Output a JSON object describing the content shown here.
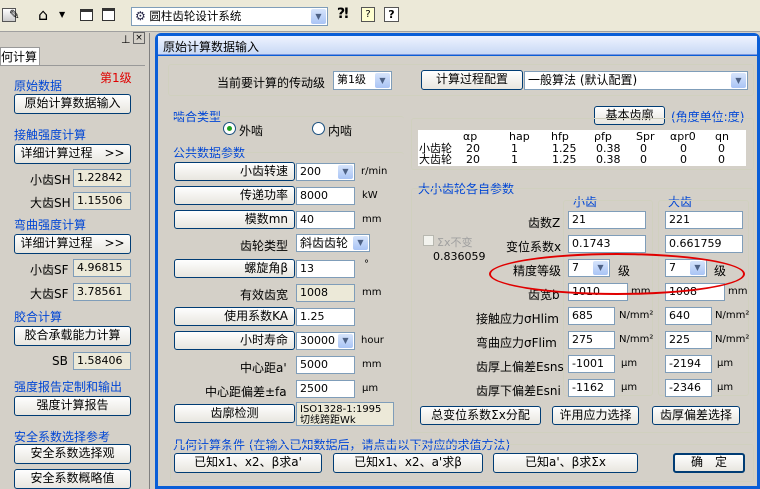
{
  "toolbar": {
    "system_select": "圆柱齿轮设计系统"
  },
  "left": {
    "tab": "何计算",
    "stage": "第1级",
    "sections": {
      "raw": "原始数据",
      "raw_btn": "原始计算数据输入",
      "contact": "接触强度计算",
      "contact_btn": "详细计算过程　>>",
      "sh_small_label": "小齿SH",
      "sh_small": "1.22842",
      "sh_big_label": "大齿SH",
      "sh_big": "1.15506",
      "bend": "弯曲强度计算",
      "bend_btn": "详细计算过程　>>",
      "sf_small_label": "小齿SF",
      "sf_small": "4.96815",
      "sf_big_label": "大齿SF",
      "sf_big": "3.78561",
      "glue": "胶合计算",
      "glue_btn": "胶合承载能力计算",
      "sb_label": "SB",
      "sb": "1.58406",
      "report": "强度报告定制和输出",
      "report_btn": "强度计算报告",
      "safety": "安全系数选择参考",
      "safety_btn1": "安全系数选择观",
      "safety_btn2": "安全系数概略值"
    }
  },
  "dialog": {
    "title": "原始计算数据输入",
    "stage_label": "当前要计算的传动级",
    "stage_value": "第1级",
    "config_btn": "计算过程配置",
    "algo_value": "一般算法 (默认配置)",
    "basic_rack_btn": "基本齿廓",
    "angle_unit": "(角度单位:度)",
    "mesh_type": {
      "title": "啮合类型",
      "outer": "外啮",
      "inner": "内啮"
    },
    "rack_table": {
      "headers": [
        "αp",
        "hap",
        "hfp",
        "ρfp",
        "Spr",
        "αpr0",
        "qn"
      ],
      "rows": [
        {
          "name": "小齿轮",
          "vals": [
            "20",
            "1",
            "1.25",
            "0.38",
            "0",
            "0",
            "0"
          ]
        },
        {
          "name": "大齿轮",
          "vals": [
            "20",
            "1",
            "1.25",
            "0.38",
            "0",
            "0",
            "0"
          ]
        }
      ]
    },
    "common": {
      "title": "公共数据参数",
      "speed_btn": "小齿转速",
      "speed": "200",
      "speed_unit": "r/min",
      "power_btn": "传递功率",
      "power": "8000",
      "power_unit": "kW",
      "module_btn": "模数mn",
      "module": "40",
      "module_unit": "mm",
      "geartype_label": "齿轮类型",
      "geartype": "斜齿齿轮",
      "helix_btn": "螺旋角β",
      "helix": "13",
      "helix_unit": "°",
      "width_label": "有效齿宽",
      "width": "1008",
      "width_unit": "mm",
      "ka_btn": "使用系数KA",
      "ka": "1.25",
      "life_btn": "小时寿命",
      "life": "30000",
      "life_unit": "hour",
      "center_label": "中心距a'",
      "center": "5000",
      "center_unit": "mm",
      "fa_label": "中心距偏差±fa",
      "fa": "2500",
      "fa_unit": "μm",
      "check_btn": "齿廓检测",
      "check_text1": "ISO1328-1:1995",
      "check_text2": "切线跨距Wk"
    },
    "gears": {
      "title": "大小齿轮各自参数",
      "small_head": "小齿",
      "big_head": "大齿",
      "sum_x_label": "Σx不变",
      "sum_x": "0.836059",
      "teeth_label": "齿数Z",
      "teeth_small": "21",
      "teeth_big": "221",
      "shift_label": "变位系数x",
      "shift_small": "0.1743",
      "shift_big": "0.661759",
      "grade_label": "精度等级",
      "grade_small": "7",
      "grade_big": "7",
      "grade_unit": "级",
      "facewidth_label": "齿宽b",
      "facewidth_small": "1010",
      "facewidth_big": "1008",
      "facewidth_unit": "mm",
      "hlim_label": "接触应力σHlim",
      "hlim_small": "685",
      "hlim_big": "640",
      "stress_unit": "N/mm²",
      "flim_label": "弯曲应力σFlim",
      "flim_small": "275",
      "flim_big": "225",
      "esns_label": "齿厚上偏差Esns",
      "esns_small": "-1001",
      "esns_big": "-2194",
      "um": "μm",
      "esni_label": "齿厚下偏差Esni",
      "esni_small": "-1162",
      "esni_big": "-2346",
      "btn_shift": "总变位系数Σx分配",
      "btn_stress": "许用应力选择",
      "btn_thick": "齿厚偏差选择"
    },
    "geometry": {
      "title": "几何计算条件 (在输入已知数据后，请点击以下对应的求值方法)",
      "btn1": "已知x1、x2、β求a'",
      "btn2": "已知x1、x2、a'求β",
      "btn3": "已知a'、β求Σx",
      "ok": "确　定"
    }
  },
  "colors": {
    "title_bar": "#0a5ed7",
    "highlight": "#e00000",
    "group_title": "#0046d5"
  }
}
